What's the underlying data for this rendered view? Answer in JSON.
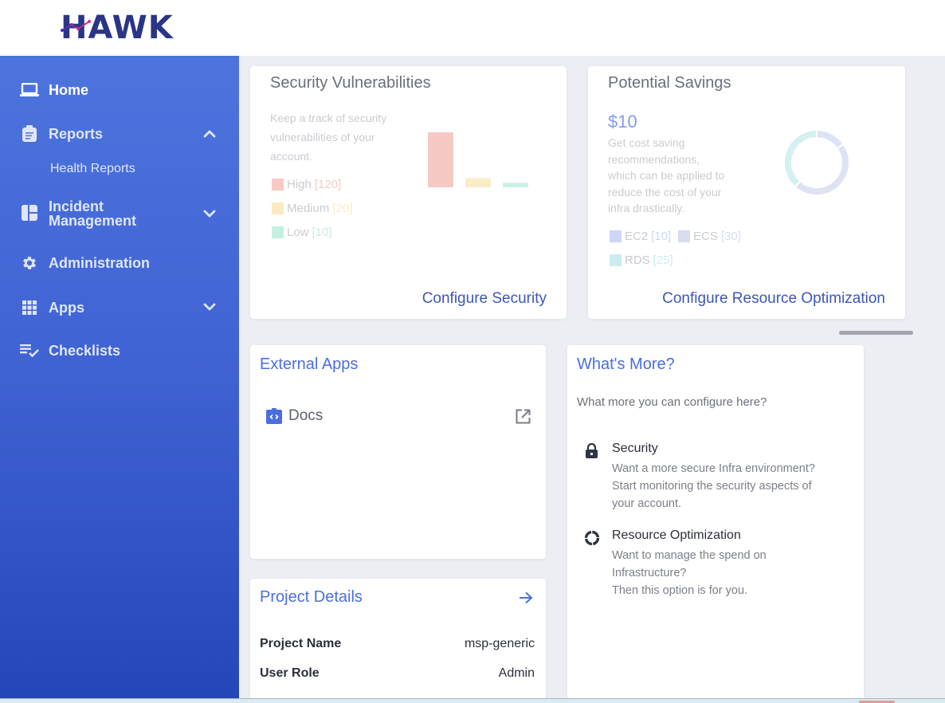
{
  "brand": {
    "name": "HAWK",
    "text_color": "#2a3585",
    "accent_gradient": [
      "#3b2fc0",
      "#e0307a"
    ]
  },
  "sidebar": {
    "items": [
      {
        "label": "Home",
        "icon": "laptop-icon",
        "active": true
      },
      {
        "label": "Reports",
        "icon": "clipboard-icon",
        "expanded": true,
        "chevron": "chevron-up-icon",
        "children": [
          {
            "label": "Health Reports"
          }
        ]
      },
      {
        "label": "Incident Management",
        "label_lines": [
          "Incident",
          "Management"
        ],
        "icon": "dashboard-icon",
        "chevron": "chevron-down-icon"
      },
      {
        "label": "Administration",
        "icon": "gear-icon"
      },
      {
        "label": "Apps",
        "icon": "grid-icon",
        "chevron": "chevron-down-icon"
      },
      {
        "label": "Checklists",
        "icon": "checklist-icon"
      }
    ]
  },
  "security_card": {
    "title": "Security Vulnerabilities",
    "description": [
      "Keep a track of security",
      "vulnerabilities of your",
      "account."
    ],
    "legend": [
      {
        "label": "High",
        "count": "[120]",
        "color": "#ee8a80"
      },
      {
        "label": "Medium",
        "count": "[20]",
        "color": "#f6d27e"
      },
      {
        "label": "Low",
        "count": "[10]",
        "color": "#7fdcb9"
      }
    ],
    "link": "Configure Security"
  },
  "savings_card": {
    "title": "Potential Savings",
    "amount": "$10",
    "description": [
      "Get cost saving",
      "recommendations,",
      "which can be applied to",
      "reduce the cost of your",
      "infra drastically."
    ],
    "legend": [
      {
        "label": "EC2",
        "count": "[10]",
        "color": "#8fa6ee"
      },
      {
        "label": "ECS",
        "count": "[30]",
        "color": "#aab4d8"
      },
      {
        "label": "RDS",
        "count": "[25]",
        "color": "#8fd8de"
      }
    ],
    "link": "Configure Resource Optimization"
  },
  "chart_data": [
    {
      "type": "bar",
      "title": "Security Vulnerabilities",
      "categories": [
        "High",
        "Medium",
        "Low"
      ],
      "values": [
        120,
        20,
        10
      ],
      "colors": [
        "#f6c9c5",
        "#fbecc8",
        "#cdf1e3"
      ],
      "ylim": [
        0,
        120
      ],
      "grid": false,
      "legend": "left"
    },
    {
      "type": "pie",
      "title": "Potential Savings",
      "categories": [
        "EC2",
        "ECS",
        "RDS"
      ],
      "values": [
        10,
        30,
        25
      ],
      "colors": [
        "#dde3f7",
        "#dfe2f2",
        "#d4f0f3"
      ],
      "donut": true,
      "legend": "left"
    }
  ],
  "external_apps": {
    "title": "External Apps",
    "items": [
      {
        "label": "Docs",
        "icon": "code-clipboard-icon",
        "action_icon": "open-external-icon"
      }
    ]
  },
  "whats_more": {
    "title": "What's More?",
    "subtitle": "What more you can configure here?",
    "items": [
      {
        "title": "Security",
        "icon": "lock-icon",
        "desc": [
          "Want a more secure Infra environment?",
          "Start monitoring the security aspects of",
          "your account."
        ]
      },
      {
        "title": "Resource Optimization",
        "icon": "loading-ring-icon",
        "desc": [
          "Want to manage the spend on",
          "Infrastructure?",
          "Then this option is for you."
        ]
      }
    ]
  },
  "project_details": {
    "title": "Project Details",
    "arrow_icon": "arrow-right-icon",
    "rows": [
      {
        "label": "Project Name",
        "value": "msp-generic"
      },
      {
        "label": "User Role",
        "value": "Admin"
      }
    ]
  }
}
